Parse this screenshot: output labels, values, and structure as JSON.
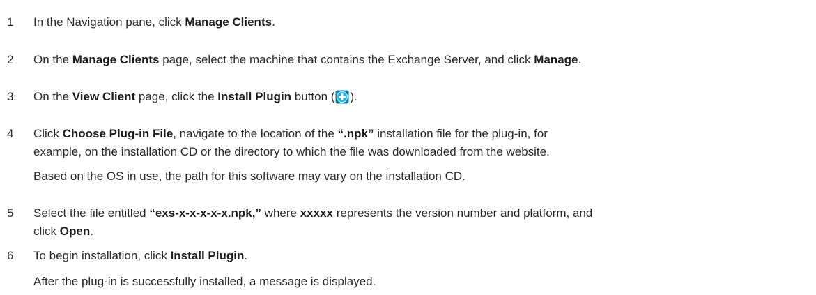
{
  "steps": [
    {
      "num": "1",
      "parts": [
        "In the Navigation pane, click ",
        "Manage Clients",
        "."
      ]
    },
    {
      "num": "2",
      "parts": [
        "On the ",
        "Manage Clients",
        " page, select the machine that contains the Exchange Server, and click ",
        "Manage",
        "."
      ]
    },
    {
      "num": "3",
      "parts": [
        "On the ",
        "View Client",
        " page, click the ",
        "Install Plugin",
        " button (",
        ")."
      ]
    },
    {
      "num": "4",
      "line1": [
        "Click ",
        "Choose Plug-in File",
        ", navigate to the location of the ",
        "“.npk”",
        " installation file for the plug-in, for"
      ],
      "line2": "example, on the installation CD or the directory to which the file was downloaded from the website.",
      "note": "Based on the OS in use, the path for this software may vary on the installation CD."
    },
    {
      "num": "5",
      "line1": [
        "Select the file entitled ",
        "“exs-x-x-x-x-x.npk,”",
        " where ",
        "xxxxx",
        " represents the version number and platform, and"
      ],
      "line2": [
        "click ",
        "Open",
        "."
      ]
    },
    {
      "num": "6",
      "parts": [
        "To begin installation, click ",
        "Install Plugin",
        "."
      ],
      "note": "After the plug-in is successfully installed, a message is displayed."
    }
  ],
  "icons": {
    "install_plugin": "plus-circle-icon",
    "install_plugin_color": "#1ea0d0"
  }
}
